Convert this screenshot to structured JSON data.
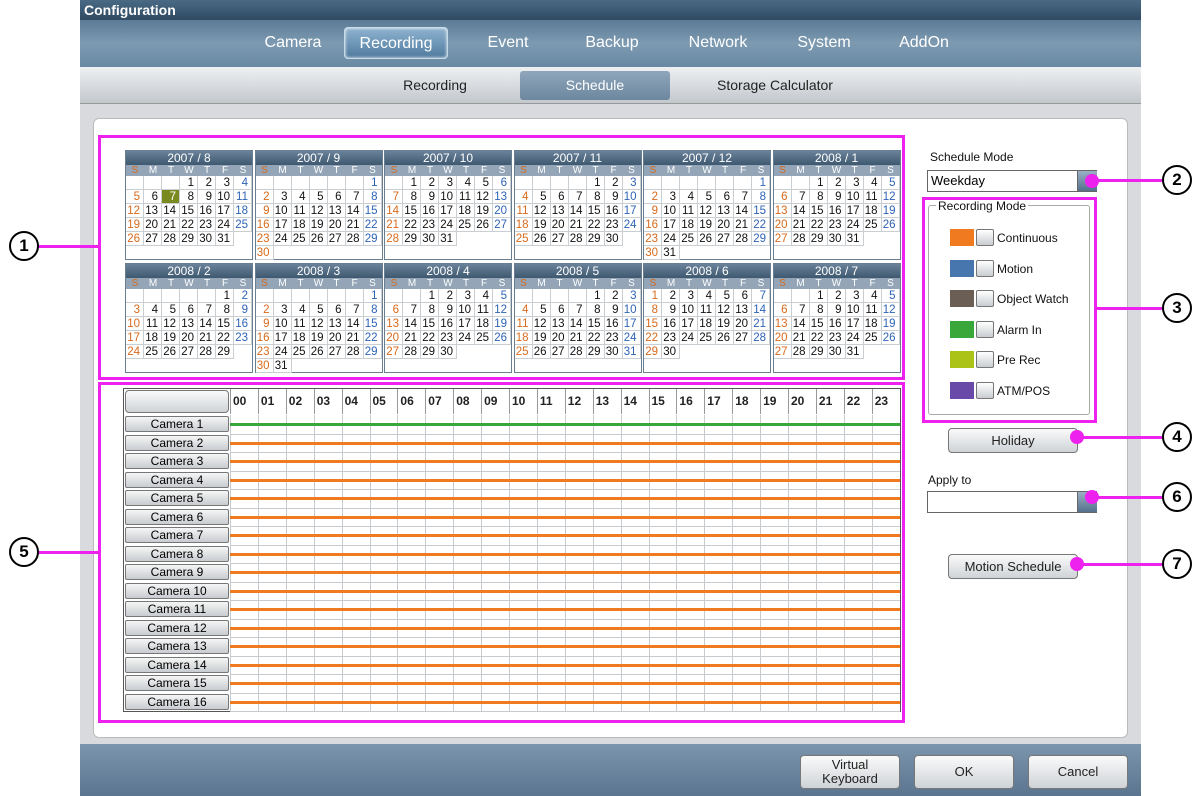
{
  "window": {
    "title": "Configuration"
  },
  "tabs": [
    "Camera",
    "Recording",
    "Event",
    "Backup",
    "Network",
    "System",
    "AddOn"
  ],
  "active_tab": "Recording",
  "subtabs": [
    "Recording",
    "Schedule",
    "Storage Calculator"
  ],
  "active_subtab": "Schedule",
  "weekday_header": [
    "S",
    "M",
    "T",
    "W",
    "T",
    "F",
    "S"
  ],
  "calendars": [
    {
      "title": "2007 / 8",
      "start": 3,
      "days": 31,
      "today": 7
    },
    {
      "title": "2007 / 9",
      "start": 6,
      "days": 30
    },
    {
      "title": "2007 / 10",
      "start": 1,
      "days": 31
    },
    {
      "title": "2007 / 11",
      "start": 4,
      "days": 30
    },
    {
      "title": "2007 / 12",
      "start": 6,
      "days": 31
    },
    {
      "title": "2008 / 1",
      "start": 2,
      "days": 31
    },
    {
      "title": "2008 / 2",
      "start": 5,
      "days": 29
    },
    {
      "title": "2008 / 3",
      "start": 6,
      "days": 31
    },
    {
      "title": "2008 / 4",
      "start": 2,
      "days": 30
    },
    {
      "title": "2008 / 5",
      "start": 4,
      "days": 31
    },
    {
      "title": "2008 / 6",
      "start": 0,
      "days": 30
    },
    {
      "title": "2008 / 7",
      "start": 2,
      "days": 31
    }
  ],
  "hours": [
    "00",
    "01",
    "02",
    "03",
    "04",
    "05",
    "06",
    "07",
    "08",
    "09",
    "10",
    "11",
    "12",
    "13",
    "14",
    "15",
    "16",
    "17",
    "18",
    "19",
    "20",
    "21",
    "22",
    "23"
  ],
  "cameras": [
    {
      "name": "Camera 1",
      "mode": "Alarm In"
    },
    {
      "name": "Camera 2",
      "mode": "Continuous"
    },
    {
      "name": "Camera 3",
      "mode": "Continuous"
    },
    {
      "name": "Camera 4",
      "mode": "Continuous"
    },
    {
      "name": "Camera 5",
      "mode": "Continuous"
    },
    {
      "name": "Camera 6",
      "mode": "Continuous"
    },
    {
      "name": "Camera 7",
      "mode": "Continuous"
    },
    {
      "name": "Camera 8",
      "mode": "Continuous"
    },
    {
      "name": "Camera 9",
      "mode": "Continuous"
    },
    {
      "name": "Camera 10",
      "mode": "Continuous"
    },
    {
      "name": "Camera 11",
      "mode": "Continuous"
    },
    {
      "name": "Camera 12",
      "mode": "Continuous"
    },
    {
      "name": "Camera 13",
      "mode": "Continuous"
    },
    {
      "name": "Camera 14",
      "mode": "Continuous"
    },
    {
      "name": "Camera 15",
      "mode": "Continuous"
    },
    {
      "name": "Camera 16",
      "mode": "Continuous"
    }
  ],
  "schedule_mode": {
    "label": "Schedule Mode",
    "value": "Weekday"
  },
  "recording_mode": {
    "label": "Recording Mode",
    "items": [
      {
        "label": "Continuous",
        "color": "#f07a1f"
      },
      {
        "label": "Motion",
        "color": "#4676ad"
      },
      {
        "label": "Object Watch",
        "color": "#6b5f55"
      },
      {
        "label": "Alarm In",
        "color": "#3aa73a"
      },
      {
        "label": "Pre Rec",
        "color": "#aac316"
      },
      {
        "label": "ATM/POS",
        "color": "#6a4aa8"
      }
    ]
  },
  "holiday_button": "Holiday",
  "apply_to": {
    "label": "Apply to",
    "value": ""
  },
  "motion_schedule_button": "Motion Schedule",
  "footer": {
    "virtual_keyboard_line1": "Virtual",
    "virtual_keyboard_line2": "Keyboard",
    "ok": "OK",
    "cancel": "Cancel"
  },
  "callouts": [
    "1",
    "2",
    "3",
    "4",
    "5",
    "6",
    "7"
  ]
}
